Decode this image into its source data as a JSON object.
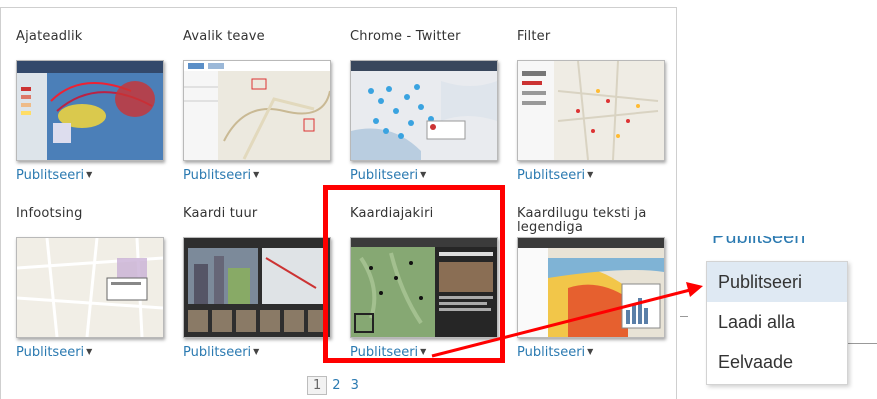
{
  "gallery": {
    "cards": [
      {
        "title": "Ajateadlik",
        "action": "Publitseeri"
      },
      {
        "title": "Avalik teave",
        "action": "Publitseeri"
      },
      {
        "title": "Chrome - Twitter",
        "action": "Publitseeri"
      },
      {
        "title": "Filter",
        "action": "Publitseeri"
      },
      {
        "title": "Infootsing",
        "action": "Publitseeri"
      },
      {
        "title": "Kaardi tuur",
        "action": "Publitseeri"
      },
      {
        "title": "Kaardiajakiri",
        "action": "Publitseeri"
      },
      {
        "title": "Kaardilugu teksti ja legendiga",
        "action": "Publitseeri"
      }
    ]
  },
  "pagination": {
    "pages": [
      "1",
      "2",
      "3"
    ],
    "current": "1"
  },
  "dropdown": {
    "header_partial": "Publitseeri",
    "items": [
      "Publitseeri",
      "Laadi alla",
      "Eelvaade"
    ],
    "active_item": "Publitseeri"
  },
  "colors": {
    "link": "#2b7ab1",
    "highlight": "#ff0000",
    "menu_active": "#dfe9f3"
  },
  "icons": {
    "caret": "caret-down-icon"
  }
}
